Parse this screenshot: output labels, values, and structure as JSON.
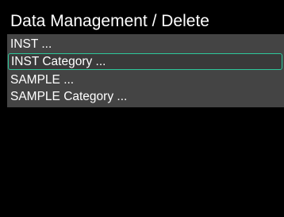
{
  "screen": {
    "title": "Data Management / Delete"
  },
  "menu": {
    "items": [
      {
        "label": "INST ...",
        "selected": false
      },
      {
        "label": "INST Category ...",
        "selected": true
      },
      {
        "label": "SAMPLE ...",
        "selected": false
      },
      {
        "label": "SAMPLE Category ...",
        "selected": false
      }
    ]
  },
  "colors": {
    "background": "#000000",
    "menu_background": "#444444",
    "selection_border": "#2ec79a",
    "text": "#ffffff"
  }
}
